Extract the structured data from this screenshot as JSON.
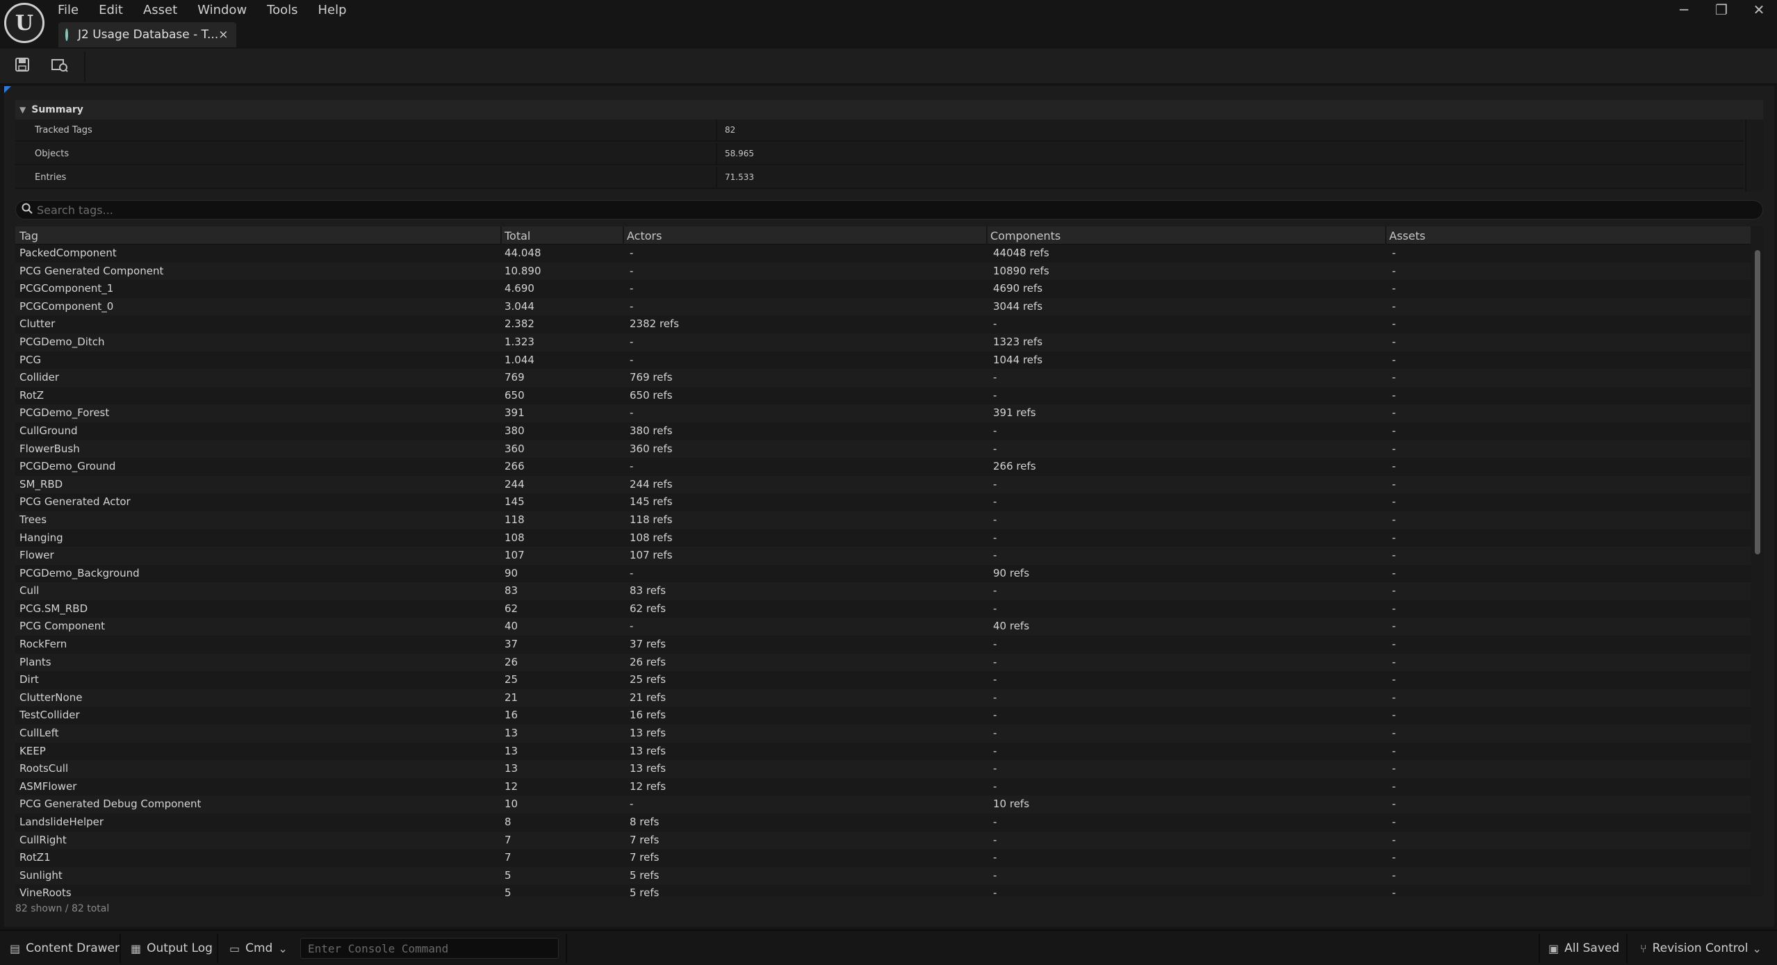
{
  "menu": [
    "File",
    "Edit",
    "Asset",
    "Window",
    "Tools",
    "Help"
  ],
  "window_controls": {
    "minimize": "─",
    "restore": "❐",
    "close": "✕"
  },
  "tab": {
    "label": "J2 Usage Database - T...",
    "close": "×"
  },
  "summary": {
    "title": "Summary",
    "rows": [
      {
        "label": "Tracked Tags",
        "value": "82"
      },
      {
        "label": "Objects",
        "value": "58.965"
      },
      {
        "label": "Entries",
        "value": "71.533"
      }
    ]
  },
  "search": {
    "placeholder": "Search tags..."
  },
  "table": {
    "headers": [
      "Tag",
      "Total",
      "Actors",
      "Components",
      "Assets"
    ],
    "rows": [
      [
        "PackedComponent",
        "44.048",
        "-",
        "44048 refs",
        "-"
      ],
      [
        "PCG Generated Component",
        "10.890",
        "-",
        "10890 refs",
        "-"
      ],
      [
        "PCGComponent_1",
        "4.690",
        "-",
        "4690 refs",
        "-"
      ],
      [
        "PCGComponent_0",
        "3.044",
        "-",
        "3044 refs",
        "-"
      ],
      [
        "Clutter",
        "2.382",
        "2382 refs",
        "-",
        "-"
      ],
      [
        "PCGDemo_Ditch",
        "1.323",
        "-",
        "1323 refs",
        "-"
      ],
      [
        "PCG",
        "1.044",
        "-",
        "1044 refs",
        "-"
      ],
      [
        "Collider",
        "769",
        "769 refs",
        "-",
        "-"
      ],
      [
        "RotZ",
        "650",
        "650 refs",
        "-",
        "-"
      ],
      [
        "PCGDemo_Forest",
        "391",
        "-",
        "391 refs",
        "-"
      ],
      [
        "CullGround",
        "380",
        "380 refs",
        "-",
        "-"
      ],
      [
        "FlowerBush",
        "360",
        "360 refs",
        "-",
        "-"
      ],
      [
        "PCGDemo_Ground",
        "266",
        "-",
        "266 refs",
        "-"
      ],
      [
        "SM_RBD",
        "244",
        "244 refs",
        "-",
        "-"
      ],
      [
        "PCG Generated Actor",
        "145",
        "145 refs",
        "-",
        "-"
      ],
      [
        "Trees",
        "118",
        "118 refs",
        "-",
        "-"
      ],
      [
        "Hanging",
        "108",
        "108 refs",
        "-",
        "-"
      ],
      [
        "Flower",
        "107",
        "107 refs",
        "-",
        "-"
      ],
      [
        "PCGDemo_Background",
        "90",
        "-",
        "90 refs",
        "-"
      ],
      [
        "Cull",
        "83",
        "83 refs",
        "-",
        "-"
      ],
      [
        "PCG.SM_RBD",
        "62",
        "62 refs",
        "-",
        "-"
      ],
      [
        "PCG Component",
        "40",
        "-",
        "40 refs",
        "-"
      ],
      [
        "RockFern",
        "37",
        "37 refs",
        "-",
        "-"
      ],
      [
        "Plants",
        "26",
        "26 refs",
        "-",
        "-"
      ],
      [
        "Dirt",
        "25",
        "25 refs",
        "-",
        "-"
      ],
      [
        "ClutterNone",
        "21",
        "21 refs",
        "-",
        "-"
      ],
      [
        "TestCollider",
        "16",
        "16 refs",
        "-",
        "-"
      ],
      [
        "CullLeft",
        "13",
        "13 refs",
        "-",
        "-"
      ],
      [
        "KEEP",
        "13",
        "13 refs",
        "-",
        "-"
      ],
      [
        "RootsCull",
        "13",
        "13 refs",
        "-",
        "-"
      ],
      [
        "ASMFlower",
        "12",
        "12 refs",
        "-",
        "-"
      ],
      [
        "PCG Generated Debug Component",
        "10",
        "-",
        "10 refs",
        "-"
      ],
      [
        "LandslideHelper",
        "8",
        "8 refs",
        "-",
        "-"
      ],
      [
        "CullRight",
        "7",
        "7 refs",
        "-",
        "-"
      ],
      [
        "RotZ1",
        "7",
        "7 refs",
        "-",
        "-"
      ],
      [
        "Sunlight",
        "5",
        "5 refs",
        "-",
        "-"
      ],
      [
        "VineRoots",
        "5",
        "5 refs",
        "-",
        "-"
      ]
    ]
  },
  "footer": {
    "count": "82 shown / 82 total"
  },
  "statusbar": {
    "content_drawer": "Content Drawer",
    "output_log": "Output Log",
    "cmd": "Cmd",
    "console_placeholder": "Enter Console Command",
    "all_saved": "All Saved",
    "revision_control": "Revision Control"
  }
}
